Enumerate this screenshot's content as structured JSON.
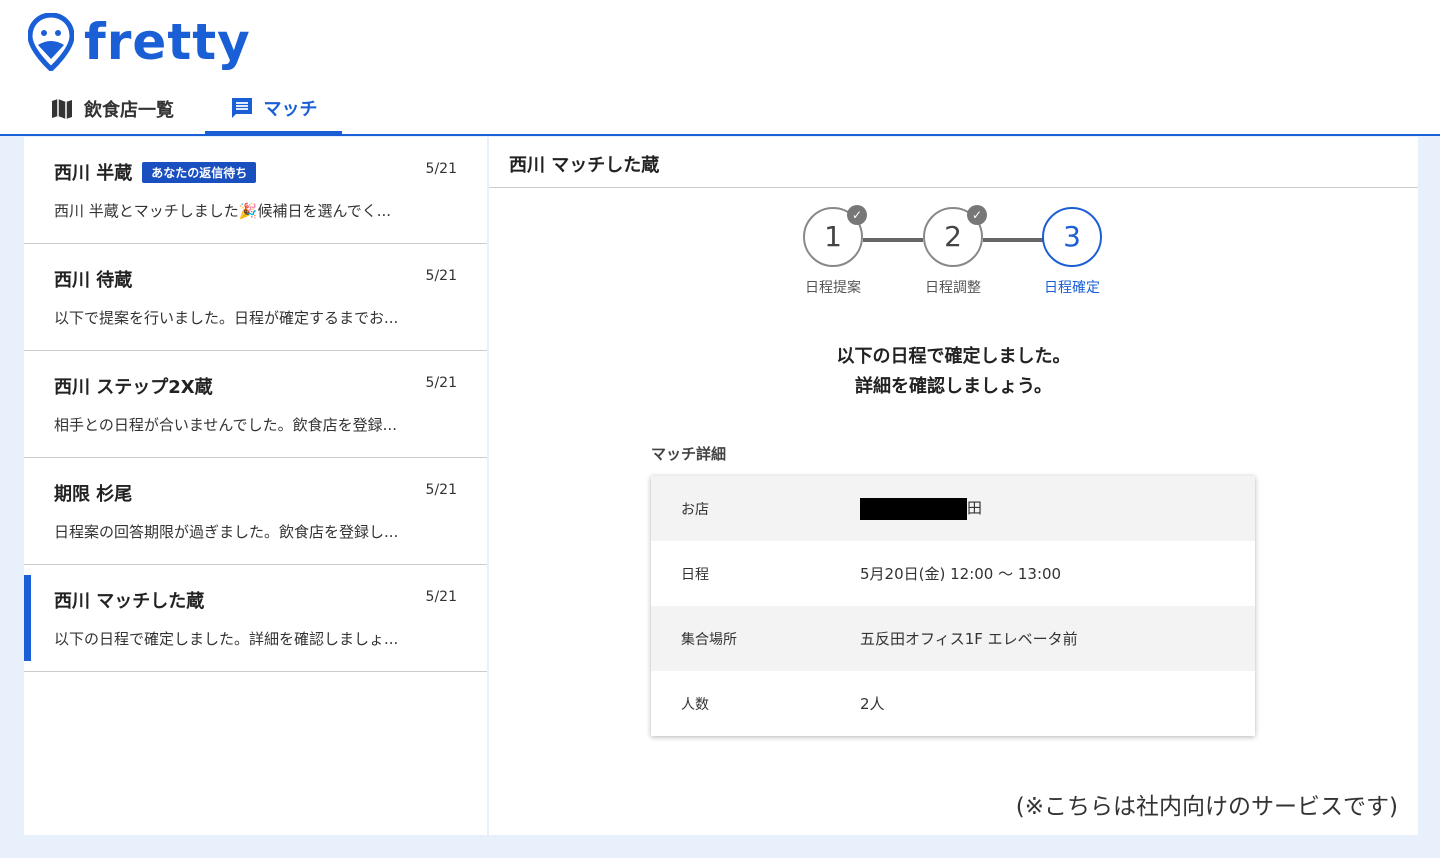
{
  "brand": {
    "name": "fretty",
    "color": "#1a5fd6"
  },
  "nav": {
    "tabs": [
      {
        "label": "飲食店一覧",
        "icon": "map-icon"
      },
      {
        "label": "マッチ",
        "icon": "chat-icon",
        "active": true
      }
    ]
  },
  "matches": [
    {
      "name": "西川 半蔵",
      "badge": "あなたの返信待ち",
      "date": "5/21",
      "message": "西川 半蔵とマッチしました🎉候補日を選んでく..."
    },
    {
      "name": "西川 待蔵",
      "date": "5/21",
      "message": "以下で提案を行いました。日程が確定するまでお..."
    },
    {
      "name": "西川 ステップ2X蔵",
      "date": "5/21",
      "message": "相手との日程が合いませんでした。飲食店を登録..."
    },
    {
      "name": "期限 杉尾",
      "date": "5/21",
      "message": "日程案の回答期限が過ぎました。飲食店を登録し..."
    },
    {
      "name": "西川 マッチした蔵",
      "date": "5/21",
      "message": "以下の日程で確定しました。詳細を確認しましょ...",
      "selected": true
    }
  ],
  "detail": {
    "title": "西川 マッチした蔵",
    "steps": [
      {
        "num": "1",
        "label": "日程提案",
        "done": true
      },
      {
        "num": "2",
        "label": "日程調整",
        "done": true
      },
      {
        "num": "3",
        "label": "日程確定",
        "current": true
      }
    ],
    "confirm_line1": "以下の日程で確定しました。",
    "confirm_line2": "詳細を確認しましょう。",
    "section_label": "マッチ詳細",
    "rows": [
      {
        "key": "お店",
        "value": "田",
        "redacted": true
      },
      {
        "key": "日程",
        "value": "5月20日(金) 12:00 〜 13:00"
      },
      {
        "key": "集合場所",
        "value": "五反田オフィス1F エレベータ前"
      },
      {
        "key": "人数",
        "value": "2人"
      }
    ],
    "note": "(※こちらは社内向けのサービスです)"
  }
}
